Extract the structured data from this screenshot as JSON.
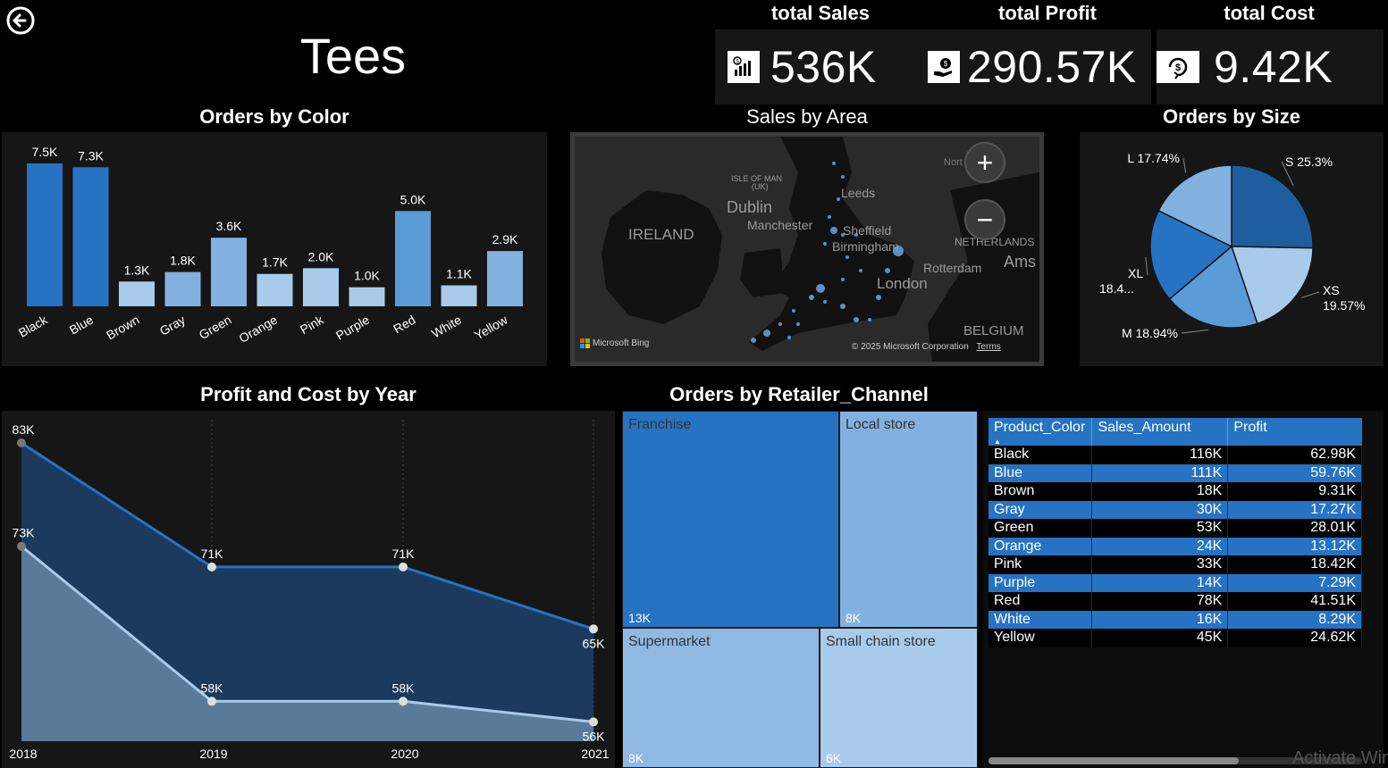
{
  "page": {
    "title": "Tees"
  },
  "kpis": [
    {
      "label": "total Sales",
      "value": "536K",
      "icon": "sales-chart-icon"
    },
    {
      "label": "total Profit",
      "value": "290.57K",
      "icon": "money-hand-icon"
    },
    {
      "label": "total Cost",
      "value": "9.42K",
      "icon": "dollar-cycle-icon"
    }
  ],
  "orders_by_color": {
    "title": "Orders by Color"
  },
  "sales_by_area": {
    "title": "Sales by Area",
    "labels": {
      "ireland": "IRELAND",
      "dublin": "Dublin",
      "isle_of_man": "ISLE OF MAN",
      "isle_of_man_sub": "(UK)",
      "leeds": "Leeds",
      "manchester": "Manchester",
      "sheffield": "Sheffield",
      "birmingham": "Birmingham",
      "london": "London",
      "netherlands": "NETHERLANDS",
      "rotterdam": "Rotterdam",
      "ams": "Ams",
      "belgium": "BELGIUM",
      "north": "Nort"
    },
    "attribution": "Microsoft Bing",
    "copyright": "© 2025 Microsoft Corporation",
    "terms": "Terms",
    "zoom_in": "+",
    "zoom_out": "−"
  },
  "orders_by_size": {
    "title": "Orders by Size"
  },
  "profit_cost_by_year": {
    "title": "Profit and Cost by Year"
  },
  "orders_by_channel": {
    "title": "Orders by Retailer_Channel",
    "cells": [
      {
        "label": "Franchise",
        "value": "13K"
      },
      {
        "label": "Local store",
        "value": "8K"
      },
      {
        "label": "Supermarket",
        "value": "8K"
      },
      {
        "label": "Small chain store",
        "value": "6K"
      }
    ]
  },
  "table": {
    "columns": [
      "Product_Color",
      "Sales_Amount",
      "Profit"
    ],
    "rows": [
      [
        "Black",
        "116K",
        "62.98K"
      ],
      [
        "Blue",
        "111K",
        "59.76K"
      ],
      [
        "Brown",
        "18K",
        "9.31K"
      ],
      [
        "Gray",
        "30K",
        "17.27K"
      ],
      [
        "Green",
        "53K",
        "28.01K"
      ],
      [
        "Orange",
        "24K",
        "13.12K"
      ],
      [
        "Pink",
        "33K",
        "18.42K"
      ],
      [
        "Purple",
        "14K",
        "7.29K"
      ],
      [
        "Red",
        "78K",
        "41.51K"
      ],
      [
        "White",
        "16K",
        "8.29K"
      ],
      [
        "Yellow",
        "45K",
        "24.62K"
      ]
    ]
  },
  "watermark": "Activate Win",
  "colors": {
    "dark_blue": "#2673c4",
    "mid_blue": "#5a9bd8",
    "light_blue": "#82b1df",
    "pale_blue": "#a9cbeb",
    "navy": "#1f4e79"
  },
  "chart_data": [
    {
      "type": "bar",
      "title": "Orders by Color",
      "categories": [
        "Black",
        "Blue",
        "Brown",
        "Gray",
        "Green",
        "Orange",
        "Pink",
        "Purple",
        "Red",
        "White",
        "Yellow"
      ],
      "values": [
        7500,
        7300,
        1300,
        1800,
        3600,
        1700,
        2000,
        1000,
        5000,
        1100,
        2900
      ],
      "data_labels": [
        "7.5K",
        "7.3K",
        "1.3K",
        "1.8K",
        "3.6K",
        "1.7K",
        "2.0K",
        "1.0K",
        "5.0K",
        "1.1K",
        "2.9K"
      ],
      "colors": [
        "#2673c4",
        "#2673c4",
        "#a9cbeb",
        "#82b1df",
        "#82b1df",
        "#a9cbeb",
        "#a9cbeb",
        "#a9cbeb",
        "#5a9bd8",
        "#a9cbeb",
        "#82b1df"
      ],
      "ylim": [
        0,
        7500
      ]
    },
    {
      "type": "pie",
      "title": "Orders by Size",
      "categories": [
        "S",
        "XS",
        "M",
        "XL",
        "L"
      ],
      "values": [
        25.3,
        19.57,
        18.94,
        18.45,
        17.74
      ],
      "data_labels": [
        "S 25.3%",
        "XS 19.57%",
        "M 18.94%",
        "XL 18.4...",
        "L 17.74%"
      ],
      "colors": [
        "#1f5e9e",
        "#a9cbeb",
        "#5a9bd8",
        "#2673c4",
        "#82b1df"
      ]
    },
    {
      "type": "area",
      "title": "Profit and Cost by Year",
      "x": [
        "2018",
        "2019",
        "2020",
        "2021"
      ],
      "series": [
        {
          "values": [
            83,
            71,
            71,
            65
          ],
          "data_labels": [
            "83K",
            "71K",
            "71K",
            "65K"
          ],
          "color": "#2673c4"
        },
        {
          "values": [
            73,
            58,
            58,
            56
          ],
          "data_labels": [
            "73K",
            "58K",
            "58K",
            "56K"
          ],
          "color": "#a9cbeb"
        }
      ],
      "ylim": [
        50,
        85
      ]
    },
    {
      "type": "treemap",
      "title": "Orders by Retailer_Channel",
      "categories": [
        "Franchise",
        "Local store",
        "Supermarket",
        "Small chain store"
      ],
      "values": [
        13000,
        8000,
        8000,
        6000
      ]
    }
  ]
}
